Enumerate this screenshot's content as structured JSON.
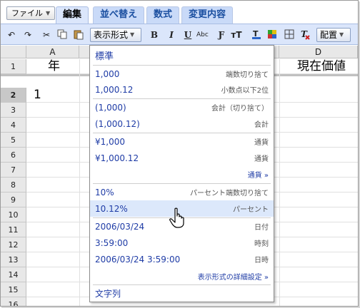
{
  "tabstrip": {
    "file_label": "ファイル",
    "tabs": [
      "編集",
      "並べ替え",
      "数式",
      "変更内容"
    ],
    "active_tab": 0
  },
  "toolbar": {
    "undo_icon": "↶",
    "redo_icon": "↷",
    "cut_icon": "✂",
    "format_dropdown_label": "表示形式",
    "bold": "B",
    "italic": "I",
    "underline": "U",
    "strike": "Abc",
    "font_family": "Ƒ",
    "font_size": "тT",
    "align_dropdown_label": "配置"
  },
  "sheet": {
    "columns": [
      "A",
      "D"
    ],
    "rows": [
      "1",
      "2",
      "3",
      "4",
      "5",
      "6",
      "7",
      "8",
      "9",
      "10",
      "11",
      "12",
      "13",
      "14",
      "15",
      "16"
    ],
    "selected_row": "2",
    "cells": {
      "A1": "年",
      "D1": "現在価値",
      "A2": "1"
    }
  },
  "format_menu": {
    "items": [
      {
        "left": "標準",
        "right": ""
      },
      {
        "left": "1,000",
        "right": "端数切り捨て"
      },
      {
        "left": "1,000.12",
        "right": "小数点以下2位"
      },
      {
        "left": "(1,000)",
        "right": "会計（切り捨て）"
      },
      {
        "left": "(1,000.12)",
        "right": "会計"
      },
      {
        "left": "¥1,000",
        "right": "通貨"
      },
      {
        "left": "¥1,000.12",
        "right": "通貨"
      },
      {
        "left": "10%",
        "right": "パーセント端数切り捨て"
      },
      {
        "left": "10.12%",
        "right": "パーセント"
      },
      {
        "left": "2006/03/24",
        "right": "日付"
      },
      {
        "left": "3:59:00",
        "right": "時刻"
      },
      {
        "left": "2006/03/24 3:59:00",
        "right": "日時"
      },
      {
        "left": "文字列",
        "right": ""
      }
    ],
    "currency_link": "通貨 »",
    "more_formats_link": "表示形式の詳細設定 »",
    "highlighted_item": 8
  },
  "colors": {
    "tab_bg": "#c9daf8",
    "toolbar_bg": "#dbe6fb",
    "menu_text": "#1f3ca6",
    "highlight": "#dce8fb"
  }
}
